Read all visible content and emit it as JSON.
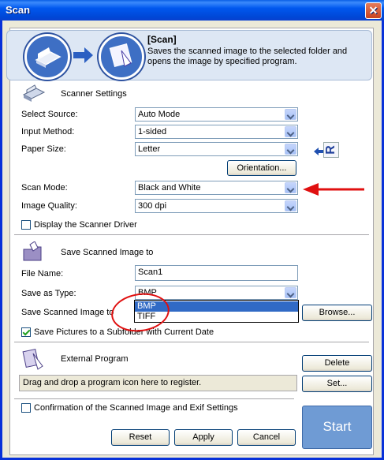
{
  "window": {
    "title": "Scan",
    "close_glyph": "✕"
  },
  "banner": {
    "title": "[Scan]",
    "description": "Saves the scanned image to the selected folder and opens the image by specified program.",
    "icons": [
      "scanner-icon",
      "arrow-right-icon",
      "viewer-app-icon"
    ]
  },
  "scanner_settings": {
    "heading": "Scanner Settings",
    "select_source": {
      "label": "Select Source:",
      "value": "Auto Mode"
    },
    "input_method": {
      "label": "Input Method:",
      "value": "1-sided"
    },
    "paper_size": {
      "label": "Paper Size:",
      "value": "Letter"
    },
    "orientation_button": "Orientation...",
    "orientation_glyph": "R",
    "scan_mode": {
      "label": "Scan Mode:",
      "value": "Black and White"
    },
    "image_quality": {
      "label": "Image Quality:",
      "value": "300 dpi"
    },
    "display_driver": {
      "label": "Display the Scanner Driver",
      "checked": false
    }
  },
  "save_settings": {
    "heading": "Save Scanned Image to",
    "file_name": {
      "label": "File Name:",
      "value": "Scan1"
    },
    "save_as_type": {
      "label": "Save as Type:",
      "value": "BMP",
      "options": [
        "BMP",
        "TIFF"
      ],
      "selected": "BMP"
    },
    "save_to": {
      "label": "Save Scanned Image to",
      "browse_button": "Browse..."
    },
    "subfolder": {
      "label": "Save Pictures to a Subfolder with Current Date",
      "checked": true
    }
  },
  "external_program": {
    "heading": "External Program",
    "delete_button": "Delete",
    "set_button": "Set...",
    "drop_hint": "Drag and drop a program icon here to register."
  },
  "confirmation": {
    "label": "Confirmation of the Scanned Image and Exif Settings",
    "checked": false
  },
  "footer": {
    "reset": "Reset",
    "apply": "Apply",
    "cancel": "Cancel",
    "start": "Start"
  },
  "colors": {
    "annotation_red": "#e01010",
    "accent_blue": "#0831d9",
    "selection_blue": "#316ac5"
  }
}
